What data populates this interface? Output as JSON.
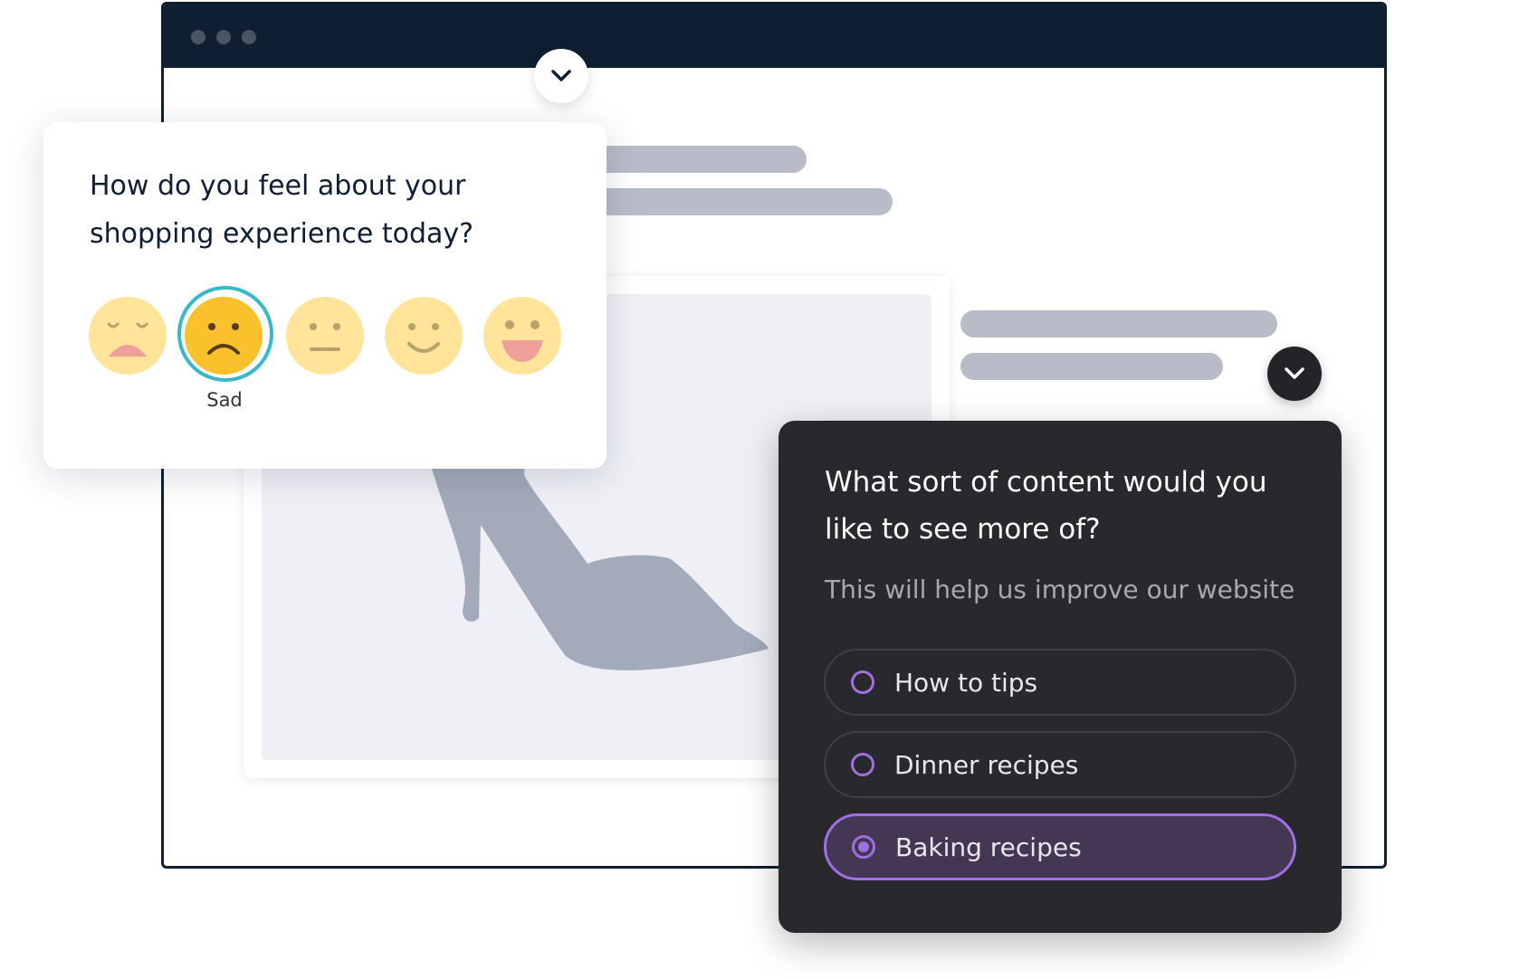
{
  "survey_emoji": {
    "question": "How do you feel about your shopping experience today?",
    "emojis": [
      {
        "icon": "very-sad-face-icon"
      },
      {
        "icon": "sad-face-icon"
      },
      {
        "icon": "neutral-face-icon"
      },
      {
        "icon": "smiling-face-icon"
      },
      {
        "icon": "very-happy-face-icon"
      }
    ],
    "selected_label": "Sad"
  },
  "survey_content": {
    "question": "What sort of content would you like to see more of?",
    "subtitle": "This will help us improve our website",
    "options": [
      {
        "label": "How to tips",
        "selected": false
      },
      {
        "label": "Dinner recipes",
        "selected": false
      },
      {
        "label": "Baking recipes",
        "selected": true
      }
    ]
  },
  "colors": {
    "browser_bar": "#0f1e31",
    "accent_teal": "#39b8c7",
    "accent_purple": "#a16fe6",
    "dark_card": "#28282d"
  }
}
